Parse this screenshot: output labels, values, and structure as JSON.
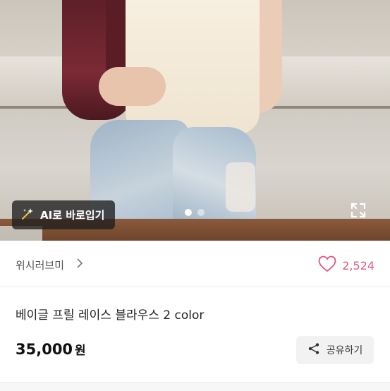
{
  "image_viewer": {
    "ai_button_label": "AI로 바로입기",
    "page_dots": {
      "count": 2,
      "active": 0
    }
  },
  "seller": {
    "name": "위시러브미"
  },
  "likes": {
    "count": "2,524"
  },
  "product": {
    "title": "베이글 프릴 레이스 블라우스 2 color",
    "price": "35,000",
    "currency": "원"
  },
  "share": {
    "label": "공유하기"
  },
  "colors": {
    "accent_pink": "#e0577a",
    "dark_overlay": "#1e1e1e"
  }
}
